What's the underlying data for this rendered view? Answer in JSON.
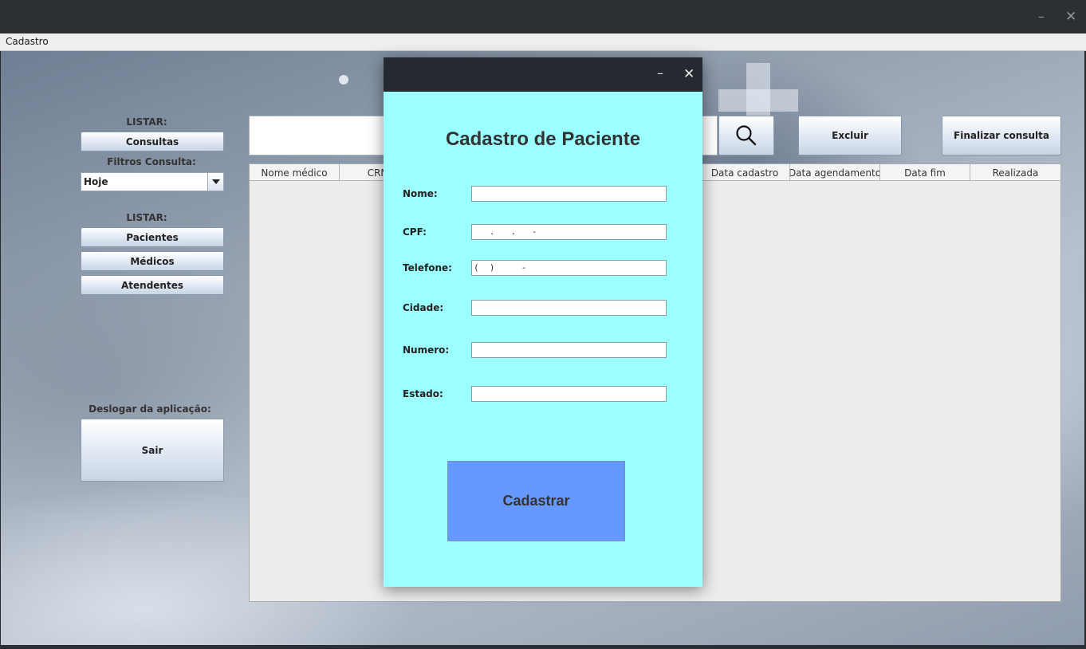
{
  "window": {
    "min_icon": "minimize-icon",
    "close_icon": "close-icon"
  },
  "menu": {
    "title": "Cadastro"
  },
  "sidebar": {
    "list_label_1": "LISTAR:",
    "consultas": "Consultas",
    "filter_label": "Filtros Consulta:",
    "filter_value": "Hoje",
    "list_label_2": "LISTAR:",
    "pacientes": "Pacientes",
    "medicos": "Médicos",
    "atendentes": "Atendentes",
    "logout_label": "Deslogar da aplicação:",
    "sair": "Sair"
  },
  "toolbar": {
    "search_value": "",
    "search_icon": "search-icon",
    "excluir": "Excluir",
    "finalizar": "Finalizar consulta"
  },
  "table": {
    "columns": [
      "Nome médico",
      "CRM m",
      "Data cadastro",
      "Data agendamento",
      "Data fim",
      "Realizada"
    ],
    "rows": []
  },
  "dialog": {
    "title": "Cadastro de Paciente",
    "fields": {
      "nome": {
        "label": "Nome:",
        "value": ""
      },
      "cpf": {
        "label": "CPF:",
        "value": "   .   .   -"
      },
      "telefone": {
        "label": "Telefone:",
        "value": "(  )     -"
      },
      "cidade": {
        "label": "Cidade:",
        "value": ""
      },
      "numero": {
        "label": "Numero:",
        "value": ""
      },
      "estado": {
        "label": "Estado:",
        "value": ""
      }
    },
    "submit": "Cadastrar"
  },
  "colors": {
    "dialog_bg": "#9bffff",
    "submit_bg": "#6699ff",
    "titlebar": "#2b3034"
  }
}
